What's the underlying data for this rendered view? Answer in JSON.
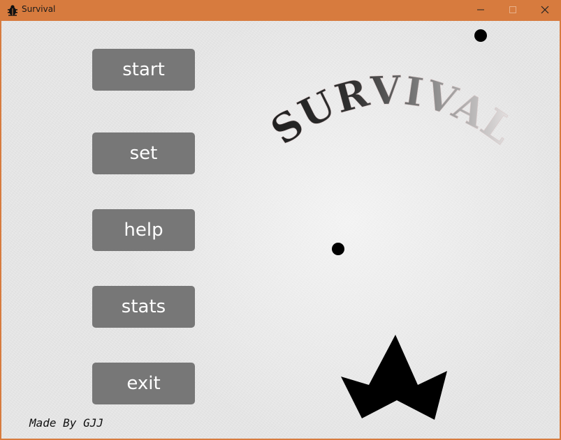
{
  "window": {
    "title": "Survival",
    "icon": "bug-icon",
    "titlebar_color": "#d77b3e",
    "controls": [
      "minimize-icon",
      "maximize-icon",
      "close-icon"
    ]
  },
  "menu": {
    "start_label": "start",
    "set_label": "set",
    "help_label": "help",
    "stats_label": "stats",
    "exit_label": "exit",
    "button_color": "#777777"
  },
  "logo": {
    "text": "SURVIVAL"
  },
  "credit": {
    "text": "Made By GJJ"
  },
  "scene": {
    "background_color": "#e7e7e7",
    "entities": [
      "enemy-dot",
      "enemy-dot",
      "player-ship"
    ]
  }
}
